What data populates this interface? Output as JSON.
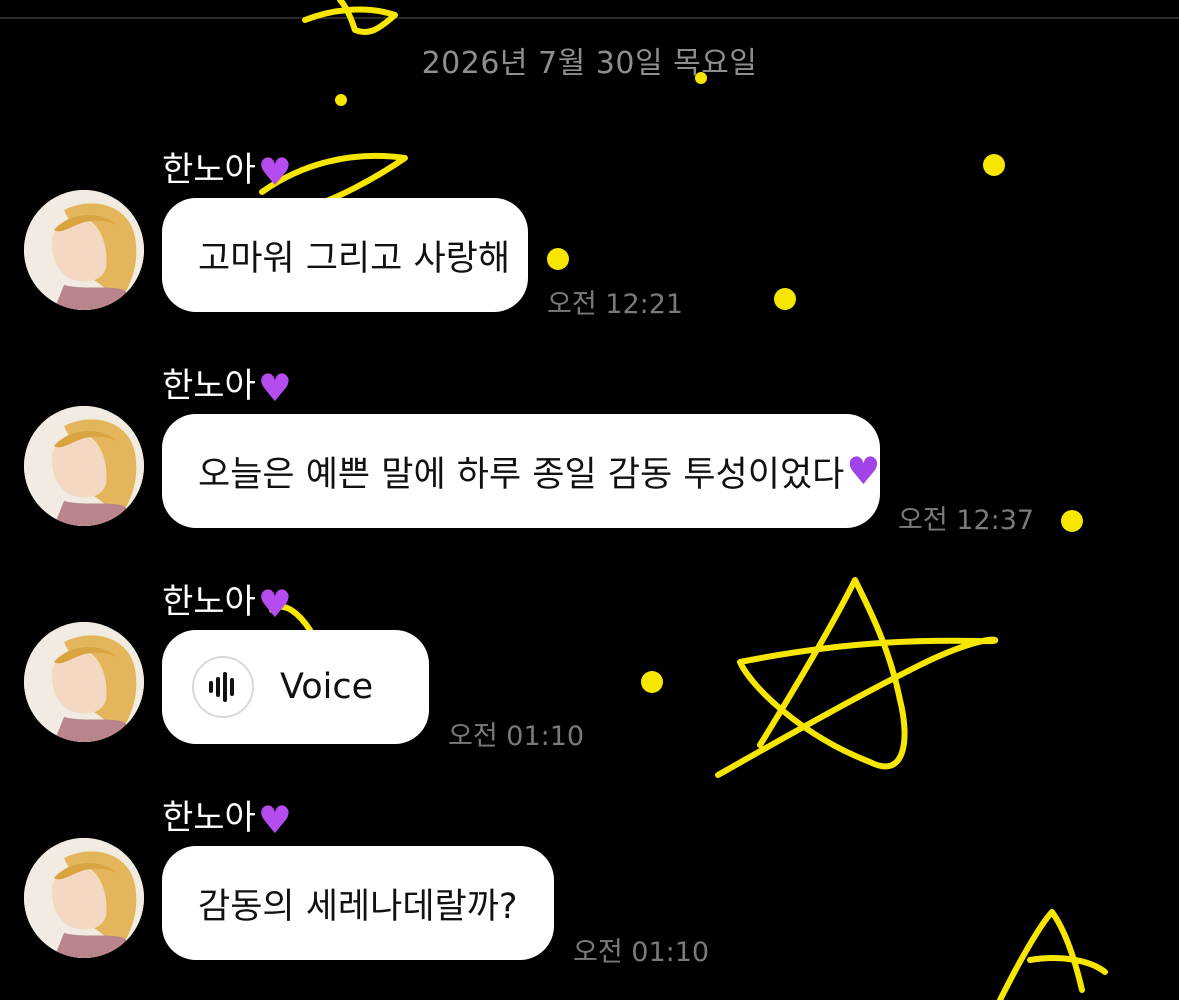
{
  "date_header": "2026년 7월 30일 목요일",
  "messages": [
    {
      "sender": "한노아",
      "sender_emoji": "💜",
      "text": "고마워 그리고 사랑해",
      "time": "오전 12:21"
    },
    {
      "sender": "한노아",
      "sender_emoji": "💜",
      "text": "오늘은 예쁜 말에 하루 종일 감동 투성이었다",
      "text_emoji": "💜",
      "time": "오전 12:37"
    },
    {
      "sender": "한노아",
      "sender_emoji": "💜",
      "type": "voice",
      "voice_label": "Voice",
      "icon": "waveform-icon",
      "time": "오전 01:10"
    },
    {
      "sender": "한노아",
      "sender_emoji": "💜",
      "text": "감동의 세레나데랄까?",
      "time": "오전 01:10"
    }
  ],
  "colors": {
    "background": "#000000",
    "bubble": "#ffffff",
    "decoration": "#f7e600",
    "heart": "#b54cf0"
  }
}
